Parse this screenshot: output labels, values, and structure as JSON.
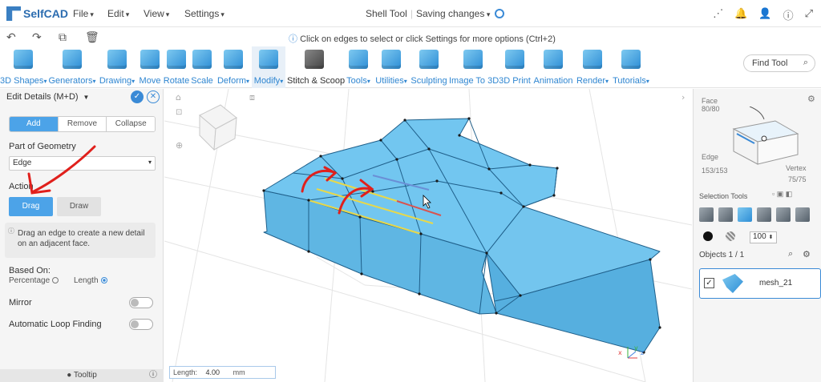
{
  "app": {
    "name": "SelfCAD"
  },
  "menus": [
    "File",
    "Edit",
    "View",
    "Settings"
  ],
  "title": {
    "tool": "Shell Tool",
    "status": "Saving changes"
  },
  "hint": "Click on edges to select or click Settings for more options (Ctrl+2)",
  "quick_icons": [
    "↶",
    "↷",
    "⧉",
    "🗑"
  ],
  "top_icons": [
    "⋰",
    "🔔",
    "👤",
    "ⓘ",
    "⤢"
  ],
  "toolbar": {
    "items": [
      {
        "label": "3D Shapes",
        "drop": true
      },
      {
        "label": "Generators",
        "drop": true
      },
      {
        "label": "Drawing",
        "drop": true
      },
      {
        "label": "Move",
        "drop": false
      },
      {
        "label": "Rotate",
        "drop": false
      },
      {
        "label": "Scale",
        "drop": false
      },
      {
        "label": "Deform",
        "drop": true
      },
      {
        "label": "Modify",
        "drop": true
      },
      {
        "label": "Stitch & Scoop",
        "drop": false
      },
      {
        "label": "Tools",
        "drop": true
      },
      {
        "label": "Utilities",
        "drop": true
      },
      {
        "label": "Sculpting",
        "drop": false
      },
      {
        "label": "Image To 3D",
        "drop": false
      },
      {
        "label": "3D Print",
        "drop": false
      },
      {
        "label": "Animation",
        "drop": false
      },
      {
        "label": "Render",
        "drop": true
      },
      {
        "label": "Tutorials",
        "drop": true
      }
    ],
    "find_placeholder": "Find Tool"
  },
  "left_panel": {
    "header": "Edit Details (M+D)",
    "tabs": [
      "Add",
      "Remove",
      "Collapse"
    ],
    "part_label": "Part of Geometry",
    "part_value": "Edge",
    "action_label": "Action",
    "action_drag": "Drag",
    "action_draw": "Draw",
    "info_text": "Drag an edge to create a new detail on an adjacent face.",
    "based_on_label": "Based On:",
    "percentage_label": "Percentage",
    "length_label": "Length",
    "mirror_label": "Mirror",
    "auto_loop_label": "Automatic Loop Finding",
    "tooltip_label": "Tooltip"
  },
  "length_box": {
    "label": "Length:",
    "value": "4.00",
    "unit": "mm"
  },
  "right_panel": {
    "face_label": "Face",
    "face_count": "80/80",
    "edge_label": "Edge",
    "edge_count": "153/153",
    "vertex_label": "Vertex",
    "vertex_count": "75/75",
    "selection_tools_label": "Selection Tools",
    "opacity_value": "100",
    "objects_label": "Objects 1 / 1",
    "object_name": "mesh_21"
  },
  "colors": {
    "accent": "#3a8ad6",
    "mesh": "#5ab8e8",
    "edge_selected": "#e8d84a",
    "edge_red": "#d9534f",
    "annotation": "#e0201c"
  }
}
